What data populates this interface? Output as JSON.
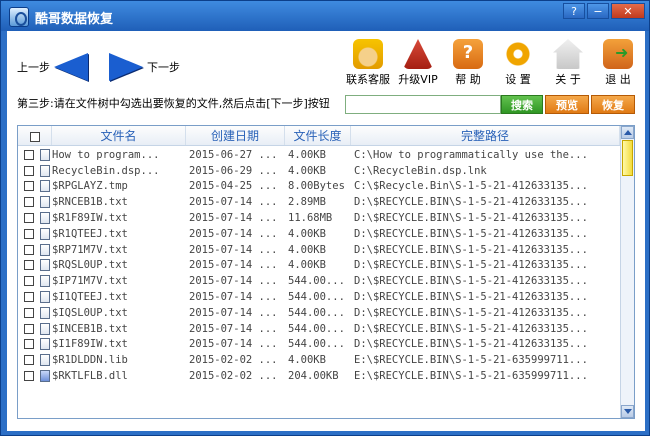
{
  "window": {
    "title": "酷哥数据恢复",
    "help_btn": "?",
    "min_btn": "−",
    "close_btn": "✕"
  },
  "nav": {
    "prev_label": "上一步",
    "next_label": "下一步"
  },
  "toolbar": {
    "items": [
      {
        "label": "联系客服",
        "icon": "customer-service-icon"
      },
      {
        "label": "升级VIP",
        "icon": "vip-crown-icon"
      },
      {
        "label": "帮 助",
        "icon": "help-icon"
      },
      {
        "label": "设 置",
        "icon": "gear-icon"
      },
      {
        "label": "关 于",
        "icon": "home-icon"
      },
      {
        "label": "退 出",
        "icon": "exit-icon"
      }
    ]
  },
  "step_instruction": "第三步:请在文件树中勾选出要恢复的文件,然后点击[下一步]按钮",
  "search": {
    "value": "",
    "button_label": "搜索"
  },
  "actions": {
    "preview_label": "预览",
    "recover_label": "恢复"
  },
  "table": {
    "headers": [
      "文件名",
      "创建日期",
      "文件长度",
      "完整路径"
    ],
    "rows": [
      {
        "name": "How to program...",
        "date": "2015-06-27 ...",
        "size": "4.00KB",
        "path": "C:\\How to programmatically use the...",
        "icon": "shortcut"
      },
      {
        "name": "RecycleBin.dsp...",
        "date": "2015-06-29 ...",
        "size": "4.00KB",
        "path": "C:\\RecycleBin.dsp.lnk",
        "icon": "shortcut"
      },
      {
        "name": "$RPGLAYZ.tmp",
        "date": "2015-04-25 ...",
        "size": "8.00Bytes",
        "path": "C:\\$Recycle.Bin\\S-1-5-21-412633135...",
        "icon": "file"
      },
      {
        "name": "$RNCEB1B.txt",
        "date": "2015-07-14 ...",
        "size": "2.89MB",
        "path": "D:\\$RECYCLE.BIN\\S-1-5-21-412633135...",
        "icon": "txt"
      },
      {
        "name": "$R1F89IW.txt",
        "date": "2015-07-14 ...",
        "size": "11.68MB",
        "path": "D:\\$RECYCLE.BIN\\S-1-5-21-412633135...",
        "icon": "txt"
      },
      {
        "name": "$R1QTEEJ.txt",
        "date": "2015-07-14 ...",
        "size": "4.00KB",
        "path": "D:\\$RECYCLE.BIN\\S-1-5-21-412633135...",
        "icon": "txt"
      },
      {
        "name": "$RP71M7V.txt",
        "date": "2015-07-14 ...",
        "size": "4.00KB",
        "path": "D:\\$RECYCLE.BIN\\S-1-5-21-412633135...",
        "icon": "txt"
      },
      {
        "name": "$RQSL0UP.txt",
        "date": "2015-07-14 ...",
        "size": "4.00KB",
        "path": "D:\\$RECYCLE.BIN\\S-1-5-21-412633135...",
        "icon": "txt"
      },
      {
        "name": "$IP71M7V.txt",
        "date": "2015-07-14 ...",
        "size": "544.00...",
        "path": "D:\\$RECYCLE.BIN\\S-1-5-21-412633135...",
        "icon": "txt"
      },
      {
        "name": "$I1QTEEJ.txt",
        "date": "2015-07-14 ...",
        "size": "544.00...",
        "path": "D:\\$RECYCLE.BIN\\S-1-5-21-412633135...",
        "icon": "txt"
      },
      {
        "name": "$IQSL0UP.txt",
        "date": "2015-07-14 ...",
        "size": "544.00...",
        "path": "D:\\$RECYCLE.BIN\\S-1-5-21-412633135...",
        "icon": "txt"
      },
      {
        "name": "$INCEB1B.txt",
        "date": "2015-07-14 ...",
        "size": "544.00...",
        "path": "D:\\$RECYCLE.BIN\\S-1-5-21-412633135...",
        "icon": "txt"
      },
      {
        "name": "$I1F89IW.txt",
        "date": "2015-07-14 ...",
        "size": "544.00...",
        "path": "D:\\$RECYCLE.BIN\\S-1-5-21-412633135...",
        "icon": "txt"
      },
      {
        "name": "$R1DLDDN.lib",
        "date": "2015-02-02 ...",
        "size": "4.00KB",
        "path": "E:\\$RECYCLE.BIN\\S-1-5-21-635999711...",
        "icon": "lib"
      },
      {
        "name": "$RKTLFLB.dll",
        "date": "2015-02-02 ...",
        "size": "204.00KB",
        "path": "E:\\$RECYCLE.BIN\\S-1-5-21-635999711...",
        "icon": "dll"
      }
    ]
  }
}
